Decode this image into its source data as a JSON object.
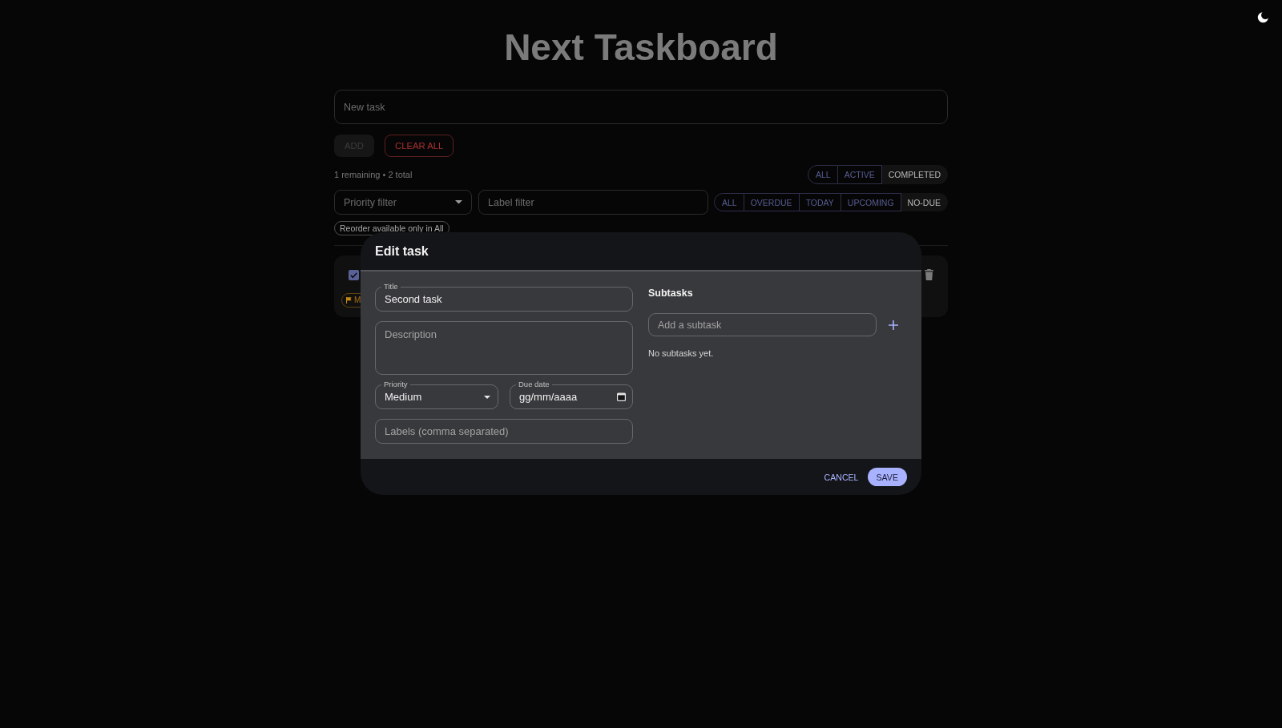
{
  "app": {
    "title": "Next Taskboard"
  },
  "new_task": {
    "placeholder": "New task"
  },
  "actions": [
    {
      "label": "ADD",
      "kind": "filled",
      "disabled": true
    },
    {
      "label": "CLEAR ALL",
      "kind": "danger",
      "disabled": false
    }
  ],
  "summary": "1 remaining • 2 total",
  "status_filter": [
    {
      "label": "ALL",
      "selected": false
    },
    {
      "label": "ACTIVE",
      "selected": false
    },
    {
      "label": "COMPLETED",
      "selected": true
    }
  ],
  "priority_filter": {
    "placeholder": "Priority filter"
  },
  "label_filter": {
    "placeholder": "Label filter"
  },
  "due_filter": [
    {
      "label": "ALL",
      "selected": false
    },
    {
      "label": "OVERDUE",
      "selected": false
    },
    {
      "label": "TODAY",
      "selected": false
    },
    {
      "label": "UPCOMING",
      "selected": false
    },
    {
      "label": "NO-DUE",
      "selected": true
    }
  ],
  "hint_chip": "Reorder available only in All",
  "tasks": [
    {
      "checked": true,
      "priority_chip": "M"
    }
  ],
  "dialog": {
    "title": "Edit task",
    "fields": [
      {
        "kind": "text",
        "label": "Title",
        "value": "Second task"
      },
      {
        "kind": "textarea",
        "placeholder": "Description"
      },
      {
        "kind": "select",
        "label": "Priority",
        "value": "Medium"
      },
      {
        "kind": "date",
        "label": "Due date",
        "value": "gg/mm/aaaa"
      },
      {
        "kind": "text",
        "placeholder": "Labels (comma separated)"
      }
    ],
    "subtasks": {
      "title": "Subtasks",
      "placeholder": "Add a subtask",
      "empty_text": "No subtasks yet."
    },
    "buttons": [
      {
        "label": "CANCEL",
        "kind": "text"
      },
      {
        "label": "SAVE",
        "kind": "contained"
      }
    ]
  }
}
